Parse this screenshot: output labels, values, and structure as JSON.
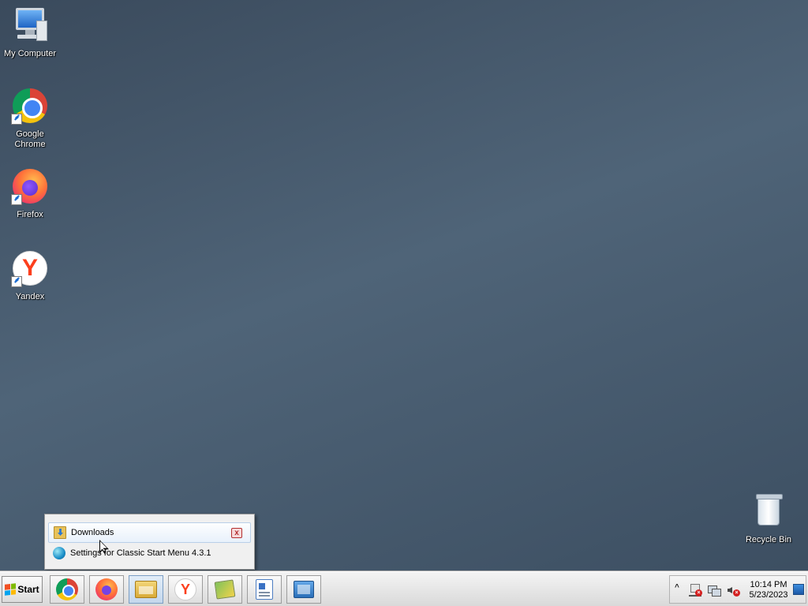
{
  "desktop": {
    "icons": [
      {
        "name": "my-computer",
        "label": "My Computer"
      },
      {
        "name": "google-chrome",
        "label": "Google Chrome"
      },
      {
        "name": "firefox",
        "label": "Firefox"
      },
      {
        "name": "yandex",
        "label": "Yandex"
      },
      {
        "name": "recycle-bin",
        "label": "Recycle Bin"
      }
    ]
  },
  "popup_menu": {
    "items": [
      {
        "label": "Downloads",
        "icon": "downloads-folder-icon",
        "highlighted": true
      },
      {
        "label": "Settings for Classic Start Menu 4.3.1",
        "icon": "settings-globe-icon",
        "highlighted": false
      }
    ],
    "close_glyph": "x"
  },
  "taskbar": {
    "start_label": "Start",
    "pinned": [
      {
        "name": "chrome",
        "icon": "chrome-icon"
      },
      {
        "name": "firefox",
        "icon": "firefox-icon"
      },
      {
        "name": "file-explorer",
        "icon": "folder-icon",
        "active": true
      },
      {
        "name": "yandex",
        "icon": "yandex-icon"
      },
      {
        "name": "photo-gallery",
        "icon": "gallery-icon"
      },
      {
        "name": "wordpad",
        "icon": "wordpad-icon"
      },
      {
        "name": "control-panel",
        "icon": "control-panel-icon"
      }
    ],
    "tray": {
      "expand_glyph": "^",
      "time": "10:14 PM",
      "date": "5/23/2023",
      "icons": [
        "action-center-flag-icon",
        "network-icon",
        "volume-icon"
      ]
    },
    "yandex_glyph": "Y"
  },
  "colors": {
    "taskbar_bg": "#dcdcdc",
    "highlight_border": "#b9cfe8",
    "yandex_red": "#fc3f1d"
  }
}
